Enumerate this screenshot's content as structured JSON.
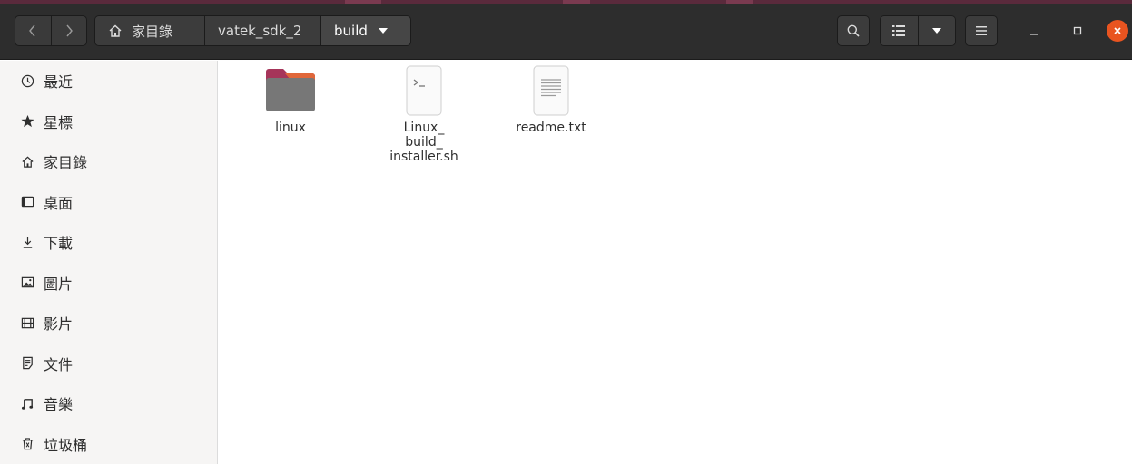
{
  "colors": {
    "headerbar": "#2d2d2d",
    "accent": "#e95420",
    "folder": "#777777",
    "folder_tab": "#a6355a"
  },
  "header": {
    "nav_back_icon": "chevron-left-icon",
    "nav_forward_icon": "chevron-right-icon",
    "breadcrumbs": [
      "家目錄",
      "vatek_sdk_2",
      "build"
    ],
    "tools": [
      "search-icon",
      "list-view-icon",
      "chevron-down-icon",
      "hamburger-menu-icon"
    ],
    "window_controls": [
      "minimize-icon",
      "maximize-icon",
      "close-icon"
    ]
  },
  "sidebar": {
    "items": [
      {
        "label": "最近",
        "icon": "clock-icon"
      },
      {
        "label": "星標",
        "icon": "star-icon"
      },
      {
        "label": "家目錄",
        "icon": "home-icon"
      },
      {
        "label": "桌面",
        "icon": "desktop-icon"
      },
      {
        "label": "下載",
        "icon": "download-icon"
      },
      {
        "label": "圖片",
        "icon": "image-icon"
      },
      {
        "label": "影片",
        "icon": "film-icon"
      },
      {
        "label": "文件",
        "icon": "document-icon"
      },
      {
        "label": "音樂",
        "icon": "music-icon"
      },
      {
        "label": "垃圾桶",
        "icon": "trash-icon"
      }
    ]
  },
  "files": [
    {
      "name": "linux",
      "type": "folder",
      "icon": "folder-icon"
    },
    {
      "name_lines": [
        "Linux_",
        "build_",
        "installer.sh"
      ],
      "type": "script",
      "icon": "terminal-script-icon"
    },
    {
      "name": "readme.txt",
      "type": "text",
      "icon": "text-file-icon"
    }
  ]
}
